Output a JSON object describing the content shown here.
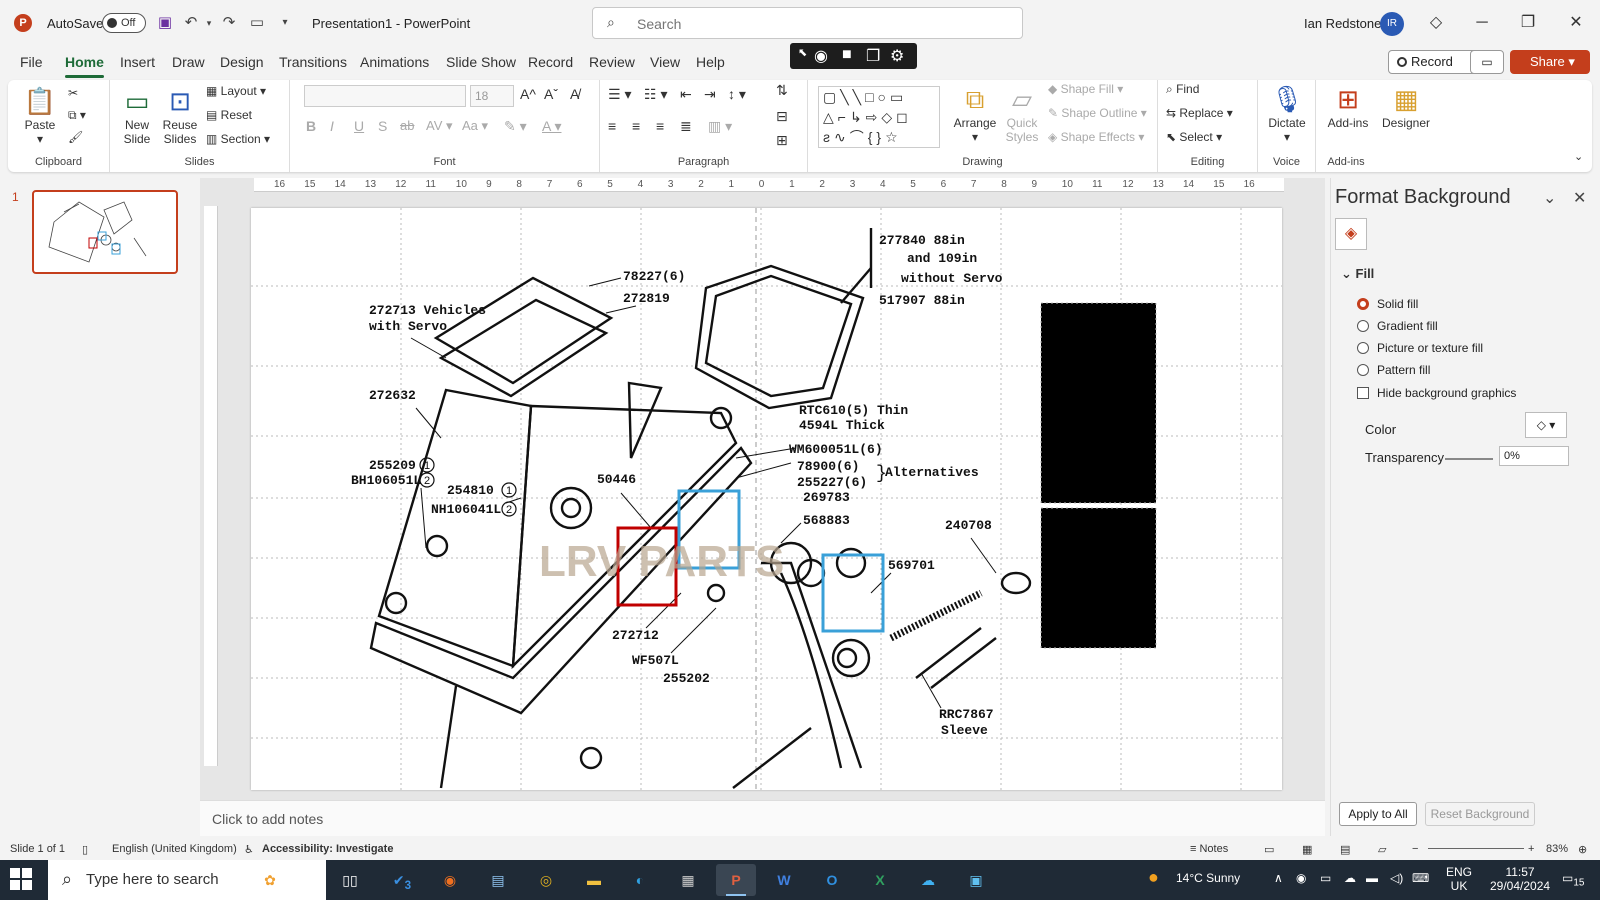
{
  "titlebar": {
    "autosave_label": "AutoSave",
    "autosave_state": "Off",
    "doc_title": "Presentation1  -  PowerPoint",
    "search_placeholder": "Search",
    "user_name": "Ian Redstone",
    "user_initials": "IR"
  },
  "tabs": [
    "File",
    "Home",
    "Insert",
    "Draw",
    "Design",
    "Transitions",
    "Animations",
    "Slide Show",
    "Record",
    "Review",
    "View",
    "Help"
  ],
  "tab_buttons": {
    "record": "Record",
    "share": "Share"
  },
  "ribbon": {
    "clipboard": {
      "label": "Clipboard",
      "paste": "Paste"
    },
    "slides": {
      "label": "Slides",
      "new_slide": "New Slide",
      "reuse_slides": "Reuse Slides",
      "layout": "Layout",
      "reset": "Reset",
      "section": "Section"
    },
    "font": {
      "label": "Font",
      "size": "18"
    },
    "paragraph": {
      "label": "Paragraph"
    },
    "drawing": {
      "label": "Drawing",
      "arrange": "Arrange",
      "quick_styles": "Quick Styles",
      "shape_fill": "Shape Fill",
      "shape_outline": "Shape Outline",
      "shape_effects": "Shape Effects"
    },
    "editing": {
      "label": "Editing",
      "find": "Find",
      "replace": "Replace",
      "select": "Select"
    },
    "voice": {
      "label": "Voice",
      "dictate": "Dictate"
    },
    "addins": {
      "label": "Add-ins",
      "addins": "Add-ins",
      "designer": "Designer"
    }
  },
  "thumbnails": {
    "slide_number": "1"
  },
  "slide": {
    "labels": [
      "277840  88in",
      "and 109in",
      "without Servo",
      "517907  88in",
      "78227(6)",
      "272819",
      "272713 Vehicles",
      "with Servo",
      "272632",
      "RTC610(5) Thin",
      "4594L    Thick",
      "WM600051L(6)",
      "78900(6)",
      "255227(6)",
      "Alternatives",
      "269783",
      "255209",
      "BH106051L",
      "254810",
      "NH106041L",
      "50446",
      "568883",
      "240708",
      "569701",
      "272712",
      "WF507L",
      "255202",
      "RRC7867",
      "Sleeve"
    ],
    "circled_1": "1",
    "circled_2": "2",
    "watermark": "LRV PARTS"
  },
  "ruler_ticks": [
    "16",
    "15",
    "14",
    "13",
    "12",
    "11",
    "10",
    "9",
    "8",
    "7",
    "6",
    "5",
    "4",
    "3",
    "2",
    "1",
    "0",
    "1",
    "2",
    "3",
    "4",
    "5",
    "6",
    "7",
    "8",
    "9",
    "10",
    "11",
    "12",
    "13",
    "14",
    "15",
    "16"
  ],
  "notes_placeholder": "Click to add notes",
  "format_pane": {
    "title": "Format Background",
    "section": "Fill",
    "options": [
      "Solid fill",
      "Gradient fill",
      "Picture or texture fill",
      "Pattern fill"
    ],
    "hide_graphics": "Hide background graphics",
    "color_label": "Color",
    "transparency_label": "Transparency",
    "transparency_value": "0%",
    "apply_all": "Apply to All",
    "reset_background": "Reset Background"
  },
  "status": {
    "slide_of": "Slide 1 of 1",
    "language": "English (United Kingdom)",
    "accessibility": "Accessibility: Investigate",
    "notes": "Notes",
    "zoom": "83%"
  },
  "taskbar": {
    "search_placeholder": "Type here to search",
    "todo_badge": "3",
    "weather": "14°C  Sunny",
    "lang1": "ENG",
    "lang2": "UK",
    "time": "11:57",
    "date": "29/04/2024",
    "notif_count": "15"
  },
  "colors": {
    "accent": "#c43e1c",
    "home_tab": "#1e6b38",
    "highlight_red": "#c00000",
    "highlight_blue": "#3aa0d8"
  }
}
